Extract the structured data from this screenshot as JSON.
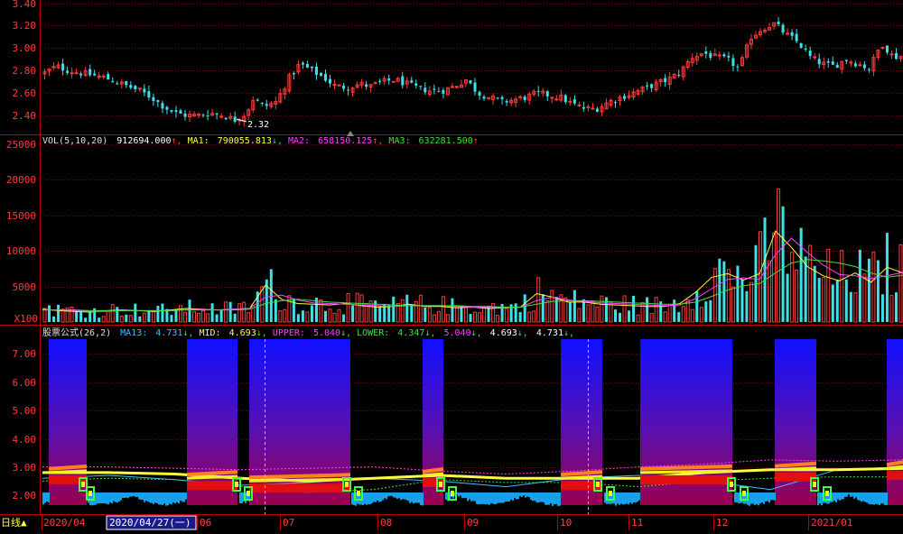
{
  "colors": {
    "up": "#ff3b3b",
    "down": "#3fe0e6",
    "grid": "#7a0000",
    "axis": "#c00000",
    "text": "#e0e0e0",
    "ma1": "#ffff40",
    "ma2": "#ff40ff",
    "ma3": "#40e040",
    "label_white": "#ffffff",
    "date_highlight": "#1a1a8a"
  },
  "price_panel": {
    "y_ticks": [
      "3.40",
      "3.20",
      "3.00",
      "2.80",
      "2.60",
      "2.40"
    ],
    "low_label": "2.32"
  },
  "volume_panel": {
    "header": {
      "name": "VOL(5,10,20)",
      "vol_value": "912694.000",
      "ma1_label": "MA1:",
      "ma1_value": "790055.813",
      "ma2_label": "MA2:",
      "ma2_value": "658150.125",
      "ma3_label": "MA3:",
      "ma3_value": "632281.500"
    },
    "y_ticks": [
      "25000",
      "20000",
      "15000",
      "10000",
      "5000"
    ],
    "multiplier": "X100"
  },
  "indicator_panel": {
    "header": {
      "name": "股票公式(26,2)",
      "ma13_label": "MA13:",
      "ma13_value": "4.731",
      "mid_label": "MID:",
      "mid_value": "4.693",
      "upper_label": "UPPER:",
      "upper_value": "5.040",
      "lower_label": "LOWER:",
      "lower_value": "4.347",
      "extra1": "5.040",
      "extra2": "4.693",
      "extra3": "4.731"
    },
    "y_ticks": [
      "7.00",
      "6.00",
      "5.00",
      "4.00",
      "3.00",
      "2.00"
    ]
  },
  "date_axis": {
    "period_button": "日线▲",
    "labels": [
      "2020/04",
      "2020/04/27(一)",
      "06",
      "07",
      "08",
      "09",
      "10",
      "11",
      "12",
      "2021/01"
    ]
  },
  "chart_data": [
    {
      "type": "candlestick",
      "ylim": [
        2.3,
        3.4
      ],
      "series": [
        {
          "x": 0,
          "y": 2.78
        },
        {
          "x": 10,
          "y": 2.84
        },
        {
          "x": 20,
          "y": 2.8
        },
        {
          "x": 30,
          "y": 2.78
        },
        {
          "x": 40,
          "y": 2.76
        },
        {
          "x": 50,
          "y": 2.74
        },
        {
          "x": 60,
          "y": 2.7
        },
        {
          "x": 70,
          "y": 2.66
        },
        {
          "x": 80,
          "y": 2.62
        },
        {
          "x": 90,
          "y": 2.56
        },
        {
          "x": 100,
          "y": 2.48
        },
        {
          "x": 110,
          "y": 2.42
        },
        {
          "x": 120,
          "y": 2.4
        },
        {
          "x": 130,
          "y": 2.4
        },
        {
          "x": 140,
          "y": 2.42
        },
        {
          "x": 150,
          "y": 2.4
        },
        {
          "x": 160,
          "y": 2.36
        },
        {
          "x": 170,
          "y": 2.42
        },
        {
          "x": 175,
          "y": 2.55
        },
        {
          "x": 185,
          "y": 2.48
        },
        {
          "x": 195,
          "y": 2.52
        },
        {
          "x": 205,
          "y": 2.72
        },
        {
          "x": 215,
          "y": 2.86
        },
        {
          "x": 225,
          "y": 2.8
        },
        {
          "x": 235,
          "y": 2.74
        },
        {
          "x": 245,
          "y": 2.66
        },
        {
          "x": 255,
          "y": 2.65
        },
        {
          "x": 265,
          "y": 2.68
        },
        {
          "x": 275,
          "y": 2.66
        },
        {
          "x": 285,
          "y": 2.7
        },
        {
          "x": 295,
          "y": 2.72
        },
        {
          "x": 305,
          "y": 2.68
        },
        {
          "x": 315,
          "y": 2.64
        },
        {
          "x": 325,
          "y": 2.62
        },
        {
          "x": 335,
          "y": 2.62
        },
        {
          "x": 345,
          "y": 2.66
        },
        {
          "x": 355,
          "y": 2.72
        },
        {
          "x": 365,
          "y": 2.6
        },
        {
          "x": 375,
          "y": 2.56
        },
        {
          "x": 385,
          "y": 2.52
        },
        {
          "x": 395,
          "y": 2.54
        },
        {
          "x": 405,
          "y": 2.56
        },
        {
          "x": 415,
          "y": 2.6
        },
        {
          "x": 425,
          "y": 2.58
        },
        {
          "x": 435,
          "y": 2.56
        },
        {
          "x": 445,
          "y": 2.5
        },
        {
          "x": 455,
          "y": 2.46
        },
        {
          "x": 465,
          "y": 2.46
        },
        {
          "x": 475,
          "y": 2.52
        },
        {
          "x": 485,
          "y": 2.56
        },
        {
          "x": 495,
          "y": 2.6
        },
        {
          "x": 505,
          "y": 2.64
        },
        {
          "x": 515,
          "y": 2.68
        },
        {
          "x": 525,
          "y": 2.72
        },
        {
          "x": 535,
          "y": 2.78
        },
        {
          "x": 545,
          "y": 2.92
        },
        {
          "x": 555,
          "y": 2.96
        },
        {
          "x": 565,
          "y": 2.92
        },
        {
          "x": 575,
          "y": 2.9
        },
        {
          "x": 585,
          "y": 2.82
        },
        {
          "x": 595,
          "y": 3.1
        },
        {
          "x": 605,
          "y": 3.18
        },
        {
          "x": 615,
          "y": 3.22
        },
        {
          "x": 625,
          "y": 3.12
        },
        {
          "x": 635,
          "y": 3.05
        },
        {
          "x": 645,
          "y": 2.92
        },
        {
          "x": 655,
          "y": 2.86
        },
        {
          "x": 665,
          "y": 2.84
        },
        {
          "x": 675,
          "y": 2.9
        },
        {
          "x": 685,
          "y": 2.86
        },
        {
          "x": 695,
          "y": 2.82
        },
        {
          "x": 705,
          "y": 3.05
        },
        {
          "x": 715,
          "y": 2.92
        },
        {
          "x": 725,
          "y": 2.94
        }
      ]
    },
    {
      "type": "bar",
      "ylim": [
        0,
        25000
      ],
      "series": [
        {
          "name": "MA1",
          "values": [
            1800,
            1600,
            1500,
            1400,
            1600,
            1700,
            1600,
            1500,
            1700,
            1900,
            1800,
            1700,
            1800,
            1900,
            5200,
            3200,
            2600,
            2500,
            2400,
            2600,
            2300,
            2100,
            2200,
            2500,
            2200,
            2200,
            2000,
            2100,
            1900,
            2000,
            2100,
            4000,
            3500,
            2800,
            2800,
            2500,
            2400,
            2300,
            2200,
            2200,
            2600,
            4200,
            6300,
            6800,
            5900,
            6800,
            12800,
            10500,
            7800,
            6500,
            5800,
            6900,
            5600,
            7700,
            6900
          ]
        },
        {
          "name": "MA2",
          "values": [
            1700,
            1700,
            1600,
            1500,
            1500,
            1600,
            1600,
            1600,
            1600,
            1700,
            1800,
            1700,
            1800,
            1900,
            3500,
            3800,
            3100,
            2700,
            2600,
            2500,
            2400,
            2300,
            2200,
            2300,
            2300,
            2300,
            2200,
            2100,
            2100,
            2000,
            2100,
            3000,
            3500,
            3100,
            2900,
            2700,
            2600,
            2500,
            2400,
            2300,
            2400,
            3300,
            4700,
            6000,
            6200,
            6000,
            9500,
            11800,
            9800,
            8000,
            6700,
            6500,
            6100,
            6500,
            7000
          ]
        },
        {
          "name": "MA3",
          "values": [
            1700,
            1700,
            1700,
            1600,
            1600,
            1600,
            1600,
            1600,
            1600,
            1700,
            1700,
            1700,
            1700,
            1800,
            2600,
            3000,
            3200,
            3000,
            2800,
            2700,
            2600,
            2500,
            2400,
            2300,
            2300,
            2300,
            2300,
            2200,
            2200,
            2100,
            2100,
            2500,
            2900,
            3000,
            3000,
            2900,
            2800,
            2700,
            2600,
            2500,
            2500,
            2800,
            3600,
            4500,
            5100,
            5400,
            6900,
            8300,
            8800,
            8600,
            8300,
            7800,
            6900,
            6300,
            6600
          ]
        }
      ]
    },
    {
      "type": "area",
      "ylim": [
        1.5,
        7.5
      ],
      "series": [
        {
          "name": "MA13",
          "values": [
            2.6,
            2.7,
            2.55,
            2.35,
            2.45,
            2.6,
            2.5,
            2.3,
            2.6,
            2.7,
            2.5,
            2.2,
            2.9,
            3.0
          ]
        },
        {
          "name": "MID",
          "values": [
            2.8,
            2.8,
            2.75,
            2.6,
            2.5,
            2.6,
            2.7,
            2.6,
            2.6,
            2.6,
            2.8,
            2.9,
            2.9,
            2.95
          ]
        },
        {
          "name": "UPPER",
          "values": [
            3.0,
            3.0,
            2.95,
            2.9,
            2.95,
            3.0,
            2.85,
            2.75,
            2.85,
            3.0,
            3.1,
            3.25,
            3.2,
            3.25
          ]
        },
        {
          "name": "LOWER",
          "values": [
            2.5,
            2.6,
            2.55,
            2.3,
            2.1,
            2.2,
            2.55,
            2.45,
            2.45,
            2.3,
            2.5,
            2.6,
            2.65,
            2.65
          ]
        }
      ]
    }
  ]
}
